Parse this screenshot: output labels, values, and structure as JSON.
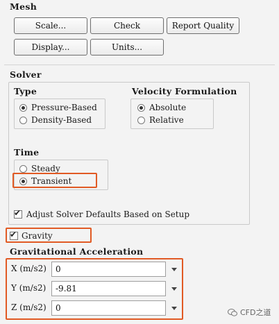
{
  "mesh": {
    "title": "Mesh",
    "buttons": {
      "scale": "Scale...",
      "check": "Check",
      "report_quality": "Report Quality",
      "display": "Display...",
      "units": "Units..."
    }
  },
  "solver": {
    "title": "Solver",
    "type": {
      "title": "Type",
      "options": [
        "Pressure-Based",
        "Density-Based"
      ],
      "selected": "Pressure-Based"
    },
    "velocity": {
      "title": "Velocity Formulation",
      "options": [
        "Absolute",
        "Relative"
      ],
      "selected": "Absolute"
    },
    "time": {
      "title": "Time",
      "options": [
        "Steady",
        "Transient"
      ],
      "selected": "Transient"
    },
    "adjust_defaults": {
      "label": "Adjust Solver Defaults Based on Setup",
      "checked": true
    }
  },
  "gravity": {
    "label": "Gravity",
    "checked": true
  },
  "grav_accel": {
    "title": "Gravitational Acceleration",
    "fields": [
      {
        "label": "X (m/s2)",
        "value": "0"
      },
      {
        "label": "Y (m/s2)",
        "value": "-9.81"
      },
      {
        "label": "Z (m/s2)",
        "value": "0"
      }
    ]
  },
  "watermark": {
    "text": "CFD之道"
  },
  "colors": {
    "highlight": "#e15a24",
    "background": "#f3f3f3"
  }
}
